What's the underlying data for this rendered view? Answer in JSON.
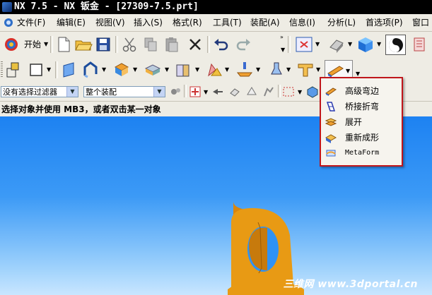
{
  "window": {
    "title": "NX 7.5 - NX 钣金 - [27309-7.5.prt]"
  },
  "menu": {
    "items": [
      {
        "label": "文件(F)"
      },
      {
        "label": "编辑(E)"
      },
      {
        "label": "视图(V)"
      },
      {
        "label": "插入(S)"
      },
      {
        "label": "格式(R)"
      },
      {
        "label": "工具(T)"
      },
      {
        "label": "装配(A)"
      },
      {
        "label": "信息(I)"
      },
      {
        "label": "分析(L)"
      },
      {
        "label": "首选项(P)"
      },
      {
        "label": "窗口"
      }
    ]
  },
  "toolbar": {
    "start_label": "开始"
  },
  "selection_bar": {
    "filter_value": "没有选择过滤器",
    "scope_value": "整个装配"
  },
  "cue_line": {
    "text": "选择对象并使用 MB3，或者双击某一对象"
  },
  "dropdown_menu": {
    "items": [
      {
        "label": "高级弯边",
        "icon": "advanced-flange-icon"
      },
      {
        "label": "桥接折弯",
        "icon": "bridge-bend-icon"
      },
      {
        "label": "展开",
        "icon": "unbend-icon"
      },
      {
        "label": "重新成形",
        "icon": "rebend-icon"
      },
      {
        "label": "MetaForm",
        "icon": "metaform-icon"
      }
    ]
  },
  "viewport": {
    "watermark": "三维网 www.3dportal.cn"
  },
  "colors": {
    "highlight_border": "#c0161b",
    "viewport_top": "#1d82f2",
    "part_color": "#e89a14"
  }
}
